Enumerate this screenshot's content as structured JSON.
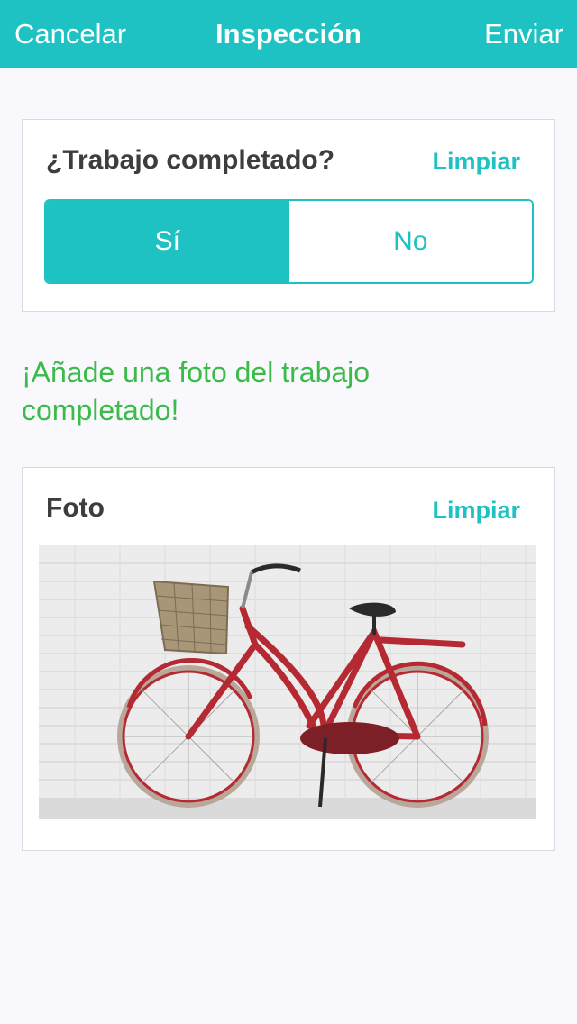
{
  "navbar": {
    "cancel_label": "Cancelar",
    "title": "Inspección",
    "send_label": "Enviar",
    "color": "#1fc2c2"
  },
  "question_card": {
    "label": "¿Trabajo completado?",
    "clear_label": "Limpiar",
    "options": [
      "Sí",
      "No"
    ],
    "selected": "Sí"
  },
  "prompt_text": "¡Añade una foto del trabajo completado!",
  "photo_card": {
    "label": "Foto",
    "clear_label": "Limpiar",
    "photo_icon": "red-bicycle-photo"
  },
  "colors": {
    "accent": "#1fc2c2",
    "prompt_green": "#3bbb4a"
  }
}
